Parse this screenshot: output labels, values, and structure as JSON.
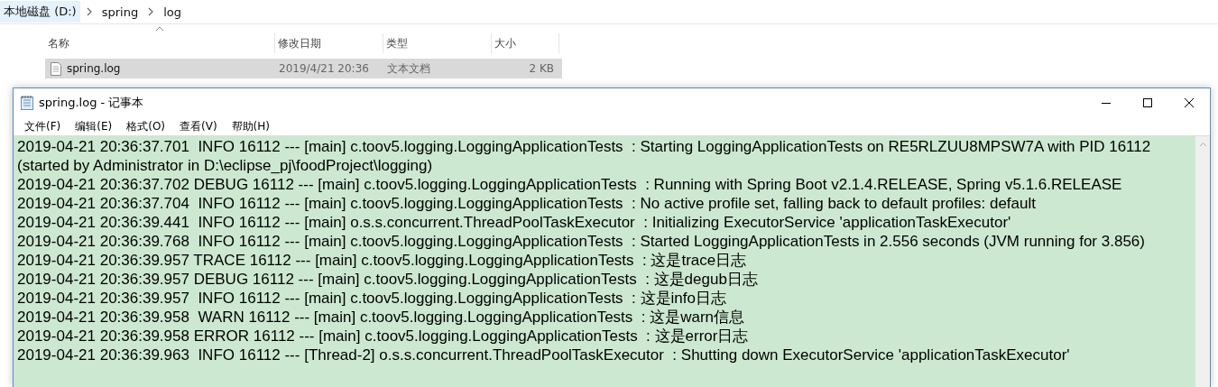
{
  "explorer": {
    "breadcrumb": [
      {
        "label": "本地磁盘 (D:)",
        "selected": true
      },
      {
        "label": "spring",
        "selected": false
      },
      {
        "label": "log",
        "selected": false
      }
    ],
    "columns": [
      "名称",
      "修改日期",
      "类型",
      "大小"
    ],
    "files": [
      {
        "name": "spring.log",
        "modified": "2019/4/21 20:36",
        "type": "文本文档",
        "size": "2 KB",
        "selected": true
      }
    ]
  },
  "window": {
    "title": "spring.log - 记事本",
    "menu": [
      "文件(F)",
      "编辑(E)",
      "格式(O)",
      "查看(V)",
      "帮助(H)"
    ],
    "lines": [
      "2019-04-21 20:36:37.701  INFO 16112 --- [main] c.toov5.logging.LoggingApplicationTests  : Starting LoggingApplicationTests on RE5RLZUU8MPSW7A with PID 16112",
      "(started by Administrator in D:\\eclipse_pj\\foodProject\\logging)",
      "2019-04-21 20:36:37.702 DEBUG 16112 --- [main] c.toov5.logging.LoggingApplicationTests  : Running with Spring Boot v2.1.4.RELEASE, Spring v5.1.6.RELEASE",
      "2019-04-21 20:36:37.704  INFO 16112 --- [main] c.toov5.logging.LoggingApplicationTests  : No active profile set, falling back to default profiles: default",
      "2019-04-21 20:36:39.441  INFO 16112 --- [main] o.s.s.concurrent.ThreadPoolTaskExecutor  : Initializing ExecutorService 'applicationTaskExecutor'",
      "2019-04-21 20:36:39.768  INFO 16112 --- [main] c.toov5.logging.LoggingApplicationTests  : Started LoggingApplicationTests in 2.556 seconds (JVM running for 3.856)",
      "2019-04-21 20:36:39.957 TRACE 16112 --- [main] c.toov5.logging.LoggingApplicationTests  : 这是trace日志",
      "2019-04-21 20:36:39.957 DEBUG 16112 --- [main] c.toov5.logging.LoggingApplicationTests  : 这是degub日志",
      "2019-04-21 20:36:39.957  INFO 16112 --- [main] c.toov5.logging.LoggingApplicationTests  : 这是info日志",
      "2019-04-21 20:36:39.958  WARN 16112 --- [main] c.toov5.logging.LoggingApplicationTests  : 这是warn信息",
      "2019-04-21 20:36:39.958 ERROR 16112 --- [main] c.toov5.logging.LoggingApplicationTests  : 这是error日志",
      "2019-04-21 20:36:39.963  INFO 16112 --- [Thread-2] o.s.s.concurrent.ThreadPoolTaskExecutor  : Shutting down ExecutorService 'applicationTaskExecutor'"
    ]
  }
}
